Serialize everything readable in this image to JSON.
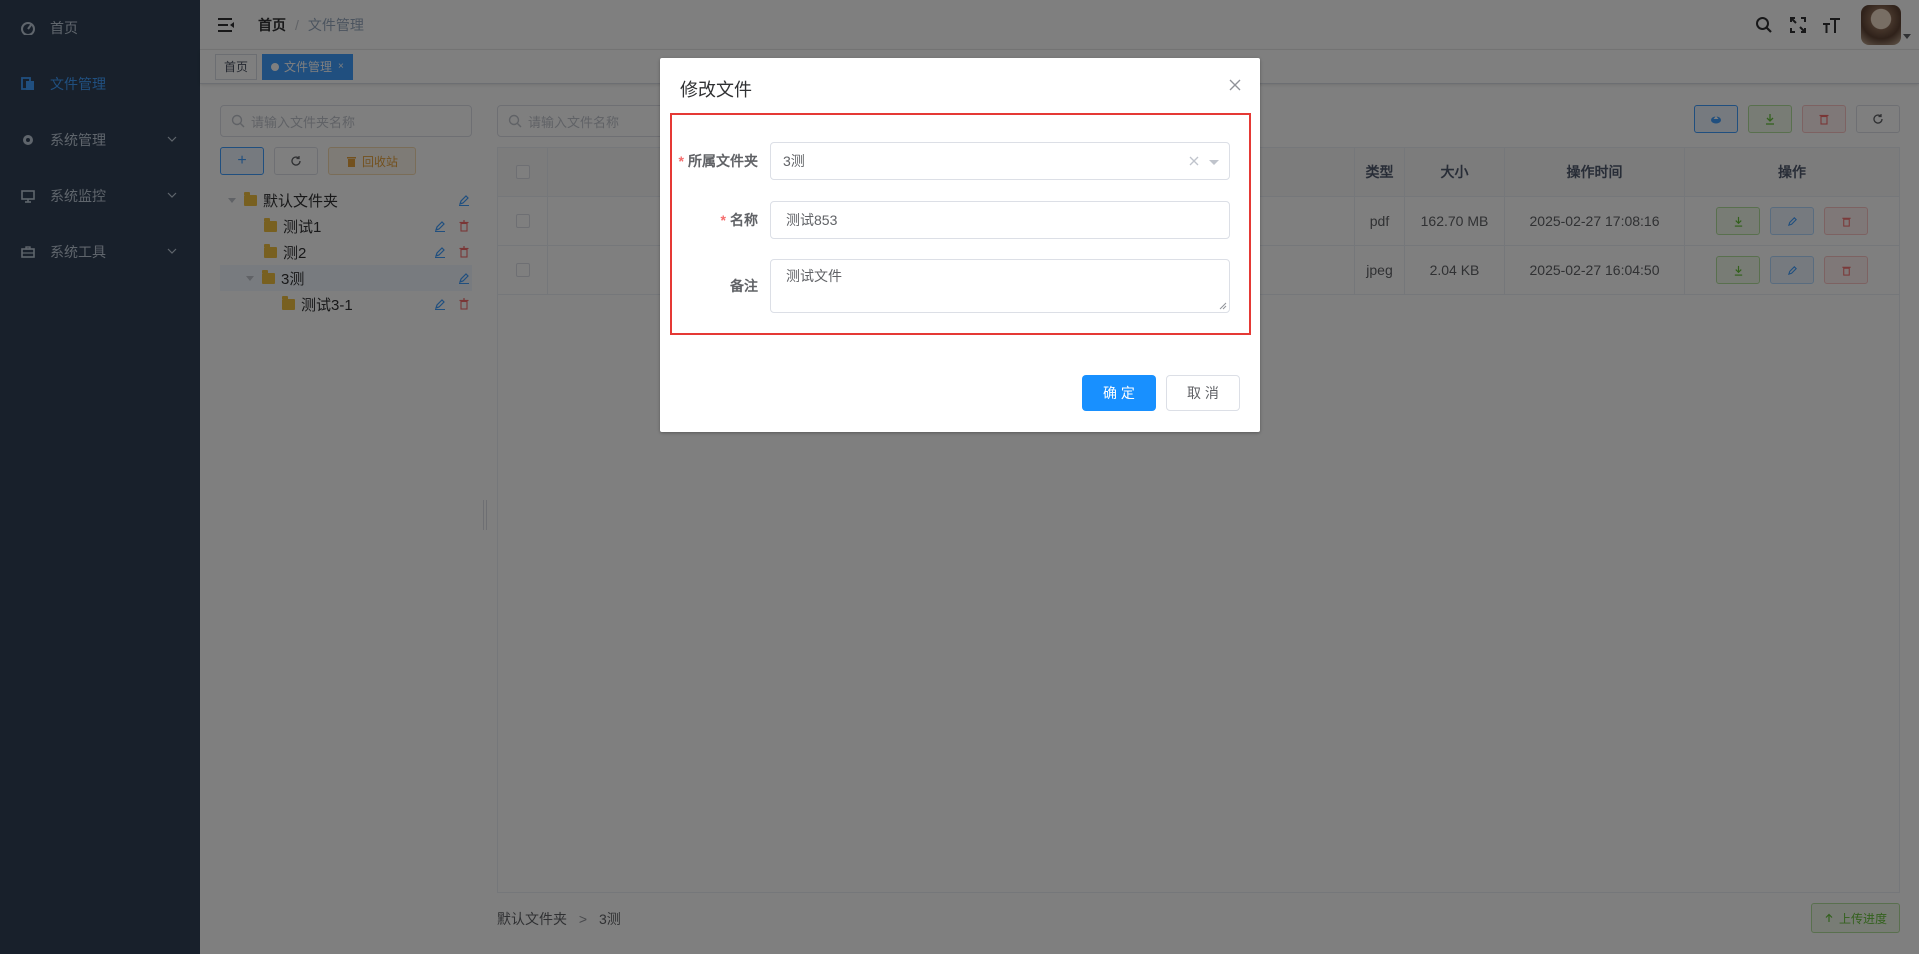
{
  "sidebar": {
    "items": [
      {
        "label": "首页",
        "icon": "dashboard-icon",
        "expandable": false,
        "active": false
      },
      {
        "label": "文件管理",
        "icon": "file-icon",
        "expandable": false,
        "active": true
      },
      {
        "label": "系统管理",
        "icon": "gear-icon",
        "expandable": true,
        "active": false
      },
      {
        "label": "系统监控",
        "icon": "monitor-icon",
        "expandable": true,
        "active": false
      },
      {
        "label": "系统工具",
        "icon": "toolbox-icon",
        "expandable": true,
        "active": false
      }
    ]
  },
  "navbar": {
    "breadcrumb": [
      "首页",
      "文件管理"
    ],
    "separator": "/",
    "icons": [
      "search-icon",
      "fullscreen-icon",
      "font-size-icon"
    ]
  },
  "tags": [
    {
      "label": "首页",
      "active": false
    },
    {
      "label": "文件管理",
      "active": true,
      "close": "×"
    }
  ],
  "folder_panel": {
    "search_placeholder": "请输入文件夹名称",
    "add_label": "+",
    "recycle_label": "回收站",
    "tree": [
      {
        "label": "默认文件夹",
        "level": 0,
        "expanded": true,
        "selected": false,
        "deletable": false
      },
      {
        "label": "测试1",
        "level": 1,
        "expanded": false,
        "selected": false,
        "deletable": true
      },
      {
        "label": "测2",
        "level": 1,
        "expanded": false,
        "selected": false,
        "deletable": true
      },
      {
        "label": "3测",
        "level": 1,
        "expanded": true,
        "selected": true,
        "deletable": false
      },
      {
        "label": "测试3-1",
        "level": 2,
        "expanded": false,
        "selected": false,
        "deletable": true
      }
    ]
  },
  "file_panel": {
    "search_placeholder": "请输入文件名称",
    "columns": {
      "type": "类型",
      "size": "大小",
      "time": "操作时间",
      "actions": "操作"
    },
    "rows": [
      {
        "type": "pdf",
        "size": "162.70 MB",
        "time": "2025-02-27 17:08:16"
      },
      {
        "type": "jpeg",
        "size": "2.04 KB",
        "time": "2025-02-27 16:04:50"
      }
    ],
    "footer_path": "默认文件夹",
    "footer_sep": ">",
    "footer_current": "3测",
    "upload_progress_label": "上传进度"
  },
  "dialog": {
    "title": "修改文件",
    "fields": {
      "folder": {
        "label": "所属文件夹",
        "required": "*",
        "value": "3测"
      },
      "name": {
        "label": "名称",
        "required": "*",
        "value": "测试853"
      },
      "remark": {
        "label": "备注",
        "value": "测试文件"
      }
    },
    "ok_label": "确 定",
    "cancel_label": "取 消"
  },
  "colors": {
    "sidebar_bg": "#304156",
    "primary": "#1890ff",
    "highlight_border": "#e53935",
    "success": "#67c23a",
    "danger": "#f56c6c",
    "warning": "#e6a23c"
  }
}
